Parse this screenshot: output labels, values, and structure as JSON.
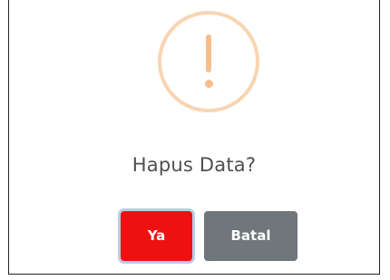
{
  "dialog": {
    "icon": "exclamation-circle-icon",
    "title": "Hapus Data?",
    "confirm_label": "Ya",
    "cancel_label": "Batal"
  },
  "colors": {
    "icon_ring": "#f8d5b2",
    "icon_mark": "#f6bf8a",
    "confirm": "#ee1111",
    "confirm_focus_ring": "#b9cde6",
    "cancel": "#6f767c",
    "title_text": "#4f4f4f"
  }
}
